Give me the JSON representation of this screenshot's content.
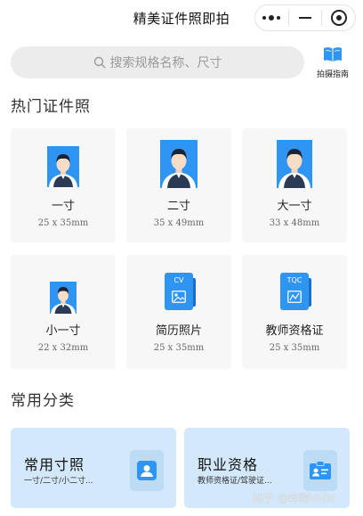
{
  "app": {
    "title": "精美证件照即拍"
  },
  "capsule": {
    "more_icon": "more-dots-icon",
    "minimize_icon": "minimize-icon",
    "close_icon": "target-circle-icon"
  },
  "search": {
    "placeholder": "搜索规格名称、尺寸",
    "icon": "search-icon"
  },
  "guide": {
    "label": "拍摄指南",
    "icon": "open-book-icon"
  },
  "sections": {
    "popular": "热门证件照",
    "categories": "常用分类"
  },
  "popular_items": [
    {
      "name": "一寸",
      "size": "25 x 35mm",
      "icon": "portrait-photo-icon"
    },
    {
      "name": "二寸",
      "size": "35 x 49mm",
      "icon": "portrait-photo-icon"
    },
    {
      "name": "大一寸",
      "size": "33 x 48mm",
      "icon": "portrait-photo-icon"
    },
    {
      "name": "小一寸",
      "size": "22 x 32mm",
      "icon": "portrait-photo-icon"
    },
    {
      "name": "简历照片",
      "size": "25 x 35mm",
      "icon": "cv-document-icon",
      "tag": "CV"
    },
    {
      "name": "教师资格证",
      "size": "25 x 35mm",
      "icon": "tqc-document-icon",
      "tag": "TQC"
    }
  ],
  "categories": [
    {
      "title": "常用寸照",
      "subtitle": "一寸/二寸/小二寸...",
      "icon": "id-portrait-icon"
    },
    {
      "title": "职业资格",
      "subtitle": "教师资格证/驾驶证...",
      "icon": "id-card-icon"
    }
  ],
  "watermark": "知乎 @奔跑Volin",
  "colors": {
    "accent": "#2f95f3",
    "card_bg": "#f7f7f7",
    "category_bg": "#d3e9fb",
    "search_bg": "#ececec"
  }
}
